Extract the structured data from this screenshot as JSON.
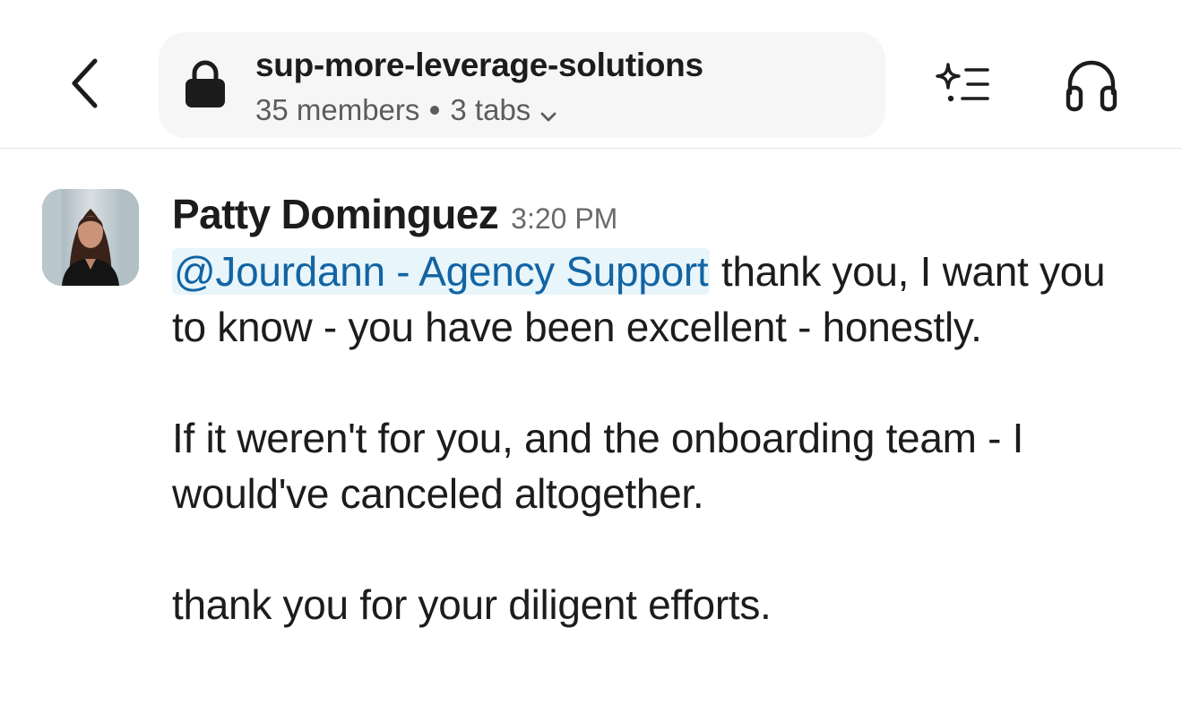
{
  "header": {
    "back_icon": "chevron-left-icon",
    "channel": {
      "lock_icon": "lock-icon",
      "name": "sup-more-leverage-solutions",
      "members": "35 members",
      "tabs": "3 tabs",
      "chevron_icon": "chevron-down-icon"
    },
    "ai_icon": "sparkle-list-icon",
    "huddle_icon": "headphones-icon"
  },
  "message": {
    "author": "Patty Dominguez",
    "time": "3:20 PM",
    "mention": "@Jourdann - Agency Support",
    "line1_rest": " thank you, I want you to know - you have been excellent - honestly.",
    "para2": "If it weren't for you, and the onboarding team - I would've canceled altogether.",
    "para3": "thank you for your diligent efforts."
  },
  "colors": {
    "mention_bg": "#e8f5fa",
    "mention_text": "#1264a3",
    "text": "#1d1c1d",
    "muted": "#5c5c5c"
  }
}
